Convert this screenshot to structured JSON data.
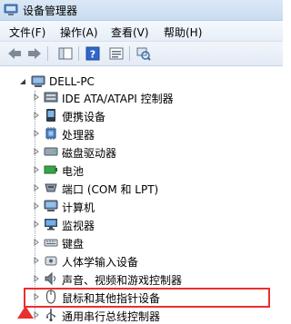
{
  "window": {
    "title": "设备管理器"
  },
  "menu": {
    "items": [
      "文件(F)",
      "操作(A)",
      "查看(V)",
      "帮助(H)"
    ]
  },
  "tree": {
    "root": "DELL-PC",
    "items": [
      {
        "label": "IDE ATA/ATAPI 控制器",
        "icon": "ide-controller-icon"
      },
      {
        "label": "便携设备",
        "icon": "portable-device-icon"
      },
      {
        "label": "处理器",
        "icon": "processor-icon"
      },
      {
        "label": "磁盘驱动器",
        "icon": "disk-drive-icon"
      },
      {
        "label": "电池",
        "icon": "battery-icon"
      },
      {
        "label": "端口 (COM 和 LPT)",
        "icon": "port-icon"
      },
      {
        "label": "计算机",
        "icon": "computer-icon"
      },
      {
        "label": "监视器",
        "icon": "monitor-icon"
      },
      {
        "label": "键盘",
        "icon": "keyboard-icon"
      },
      {
        "label": "人体学输入设备",
        "icon": "hid-icon"
      },
      {
        "label": "声音、视频和游戏控制器",
        "icon": "sound-icon"
      },
      {
        "label": "鼠标和其他指针设备",
        "icon": "mouse-icon"
      },
      {
        "label": "通用串行总线控制器",
        "icon": "usb-icon"
      }
    ]
  },
  "annotation": {
    "color": "#e83030",
    "highlighted_item": "鼠标和其他指针设备"
  }
}
